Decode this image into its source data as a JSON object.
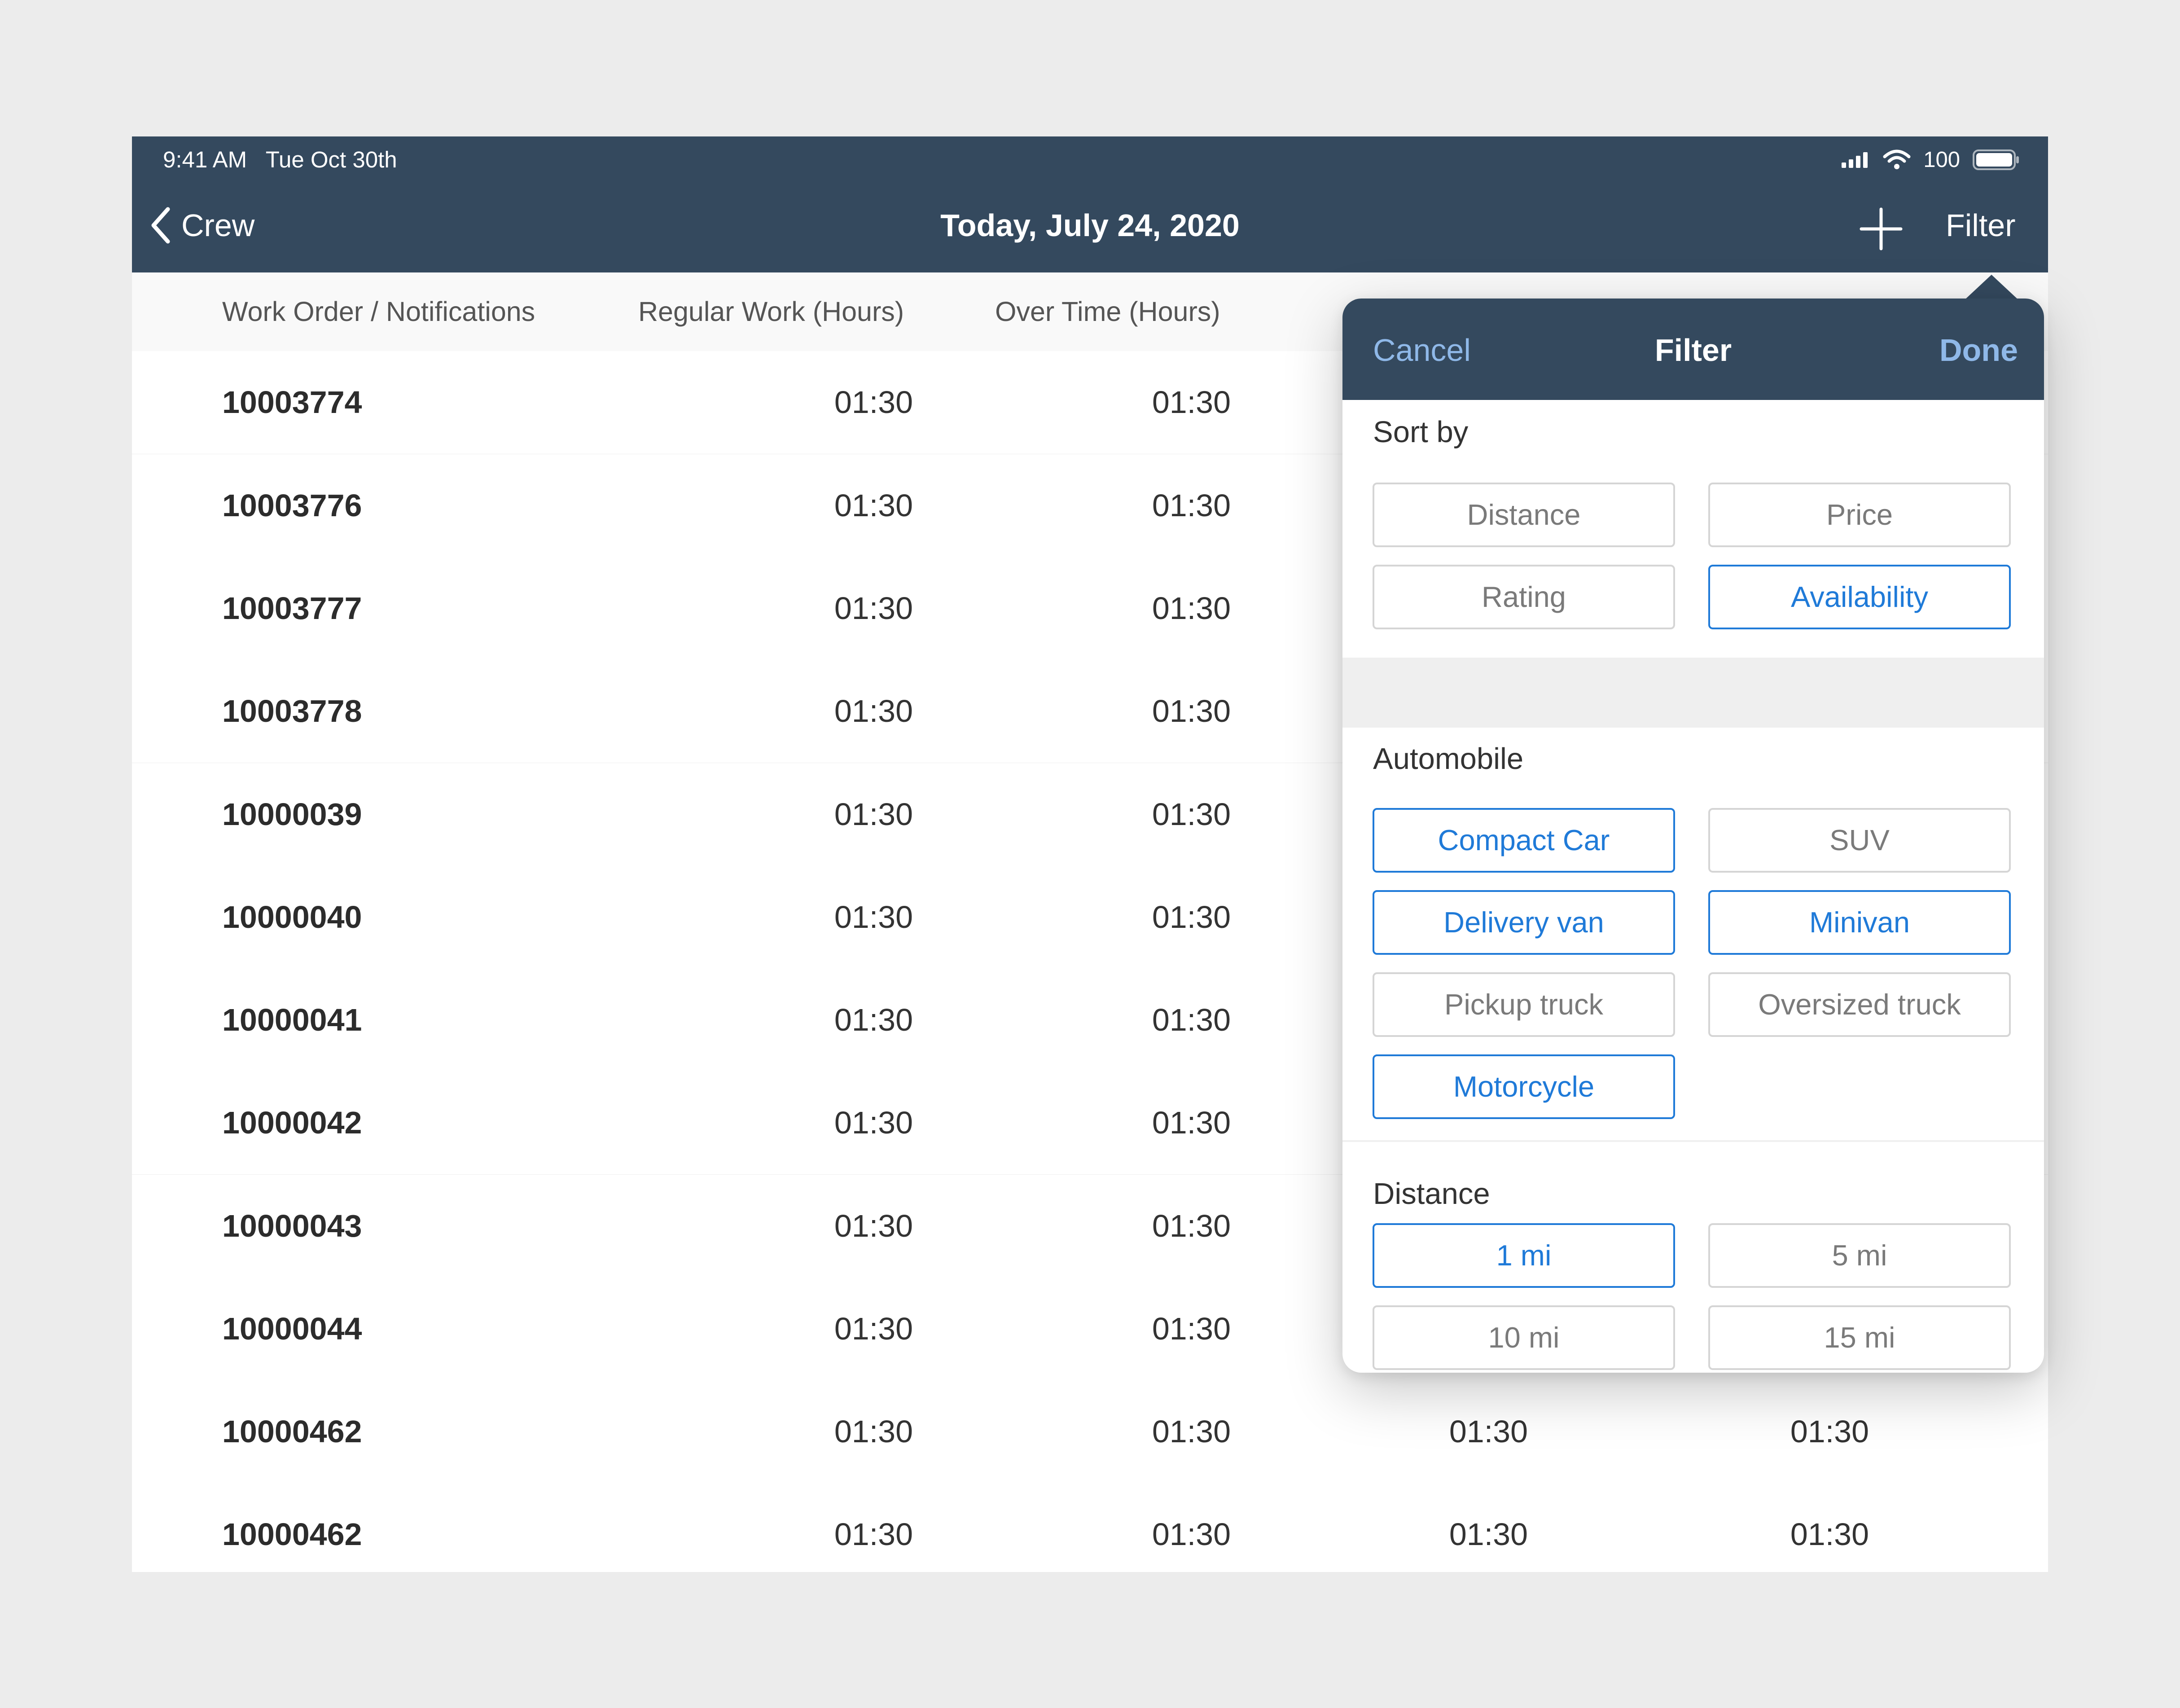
{
  "status_bar": {
    "time": "9:41 AM",
    "date": "Tue Oct 30th",
    "battery": "100",
    "icons": [
      "signal-icon",
      "wifi-icon",
      "battery-icon"
    ]
  },
  "nav": {
    "back_label": "Crew",
    "title": "Today, July 24, 2020",
    "filter_label": "Filter"
  },
  "table": {
    "columns": [
      "Work Order / Notifications",
      "Regular Work (Hours)",
      "Over Time (Hours)"
    ],
    "rows": [
      {
        "id": "10003774",
        "regular": "01:30",
        "overtime": "01:30"
      },
      {
        "id": "10003776",
        "regular": "01:30",
        "overtime": "01:30"
      },
      {
        "id": "10003777",
        "regular": "01:30",
        "overtime": "01:30"
      },
      {
        "id": "10003778",
        "regular": "01:30",
        "overtime": "01:30"
      },
      {
        "id": "10000039",
        "regular": "01:30",
        "overtime": "01:30"
      },
      {
        "id": "10000040",
        "regular": "01:30",
        "overtime": "01:30"
      },
      {
        "id": "10000041",
        "regular": "01:30",
        "overtime": "01:30"
      },
      {
        "id": "10000042",
        "regular": "01:30",
        "overtime": "01:30"
      },
      {
        "id": "10000043",
        "regular": "01:30",
        "overtime": "01:30"
      },
      {
        "id": "10000044",
        "regular": "01:30",
        "overtime": "01:30"
      },
      {
        "id": "10000462",
        "regular": "01:30",
        "overtime": "01:30",
        "col4": "01:30",
        "col5": "01:30"
      },
      {
        "id": "10000462",
        "regular": "01:30",
        "overtime": "01:30",
        "col4": "01:30",
        "col5": "01:30"
      }
    ]
  },
  "filter_popover": {
    "cancel_label": "Cancel",
    "title": "Filter",
    "done_label": "Done",
    "sort_by": {
      "label": "Sort by",
      "options": [
        {
          "label": "Distance",
          "selected": false
        },
        {
          "label": "Price",
          "selected": false
        },
        {
          "label": "Rating",
          "selected": false
        },
        {
          "label": "Availability",
          "selected": true
        }
      ]
    },
    "automobile": {
      "label": "Automobile",
      "options": [
        {
          "label": "Compact Car",
          "selected": true
        },
        {
          "label": "SUV",
          "selected": false
        },
        {
          "label": "Delivery van",
          "selected": true
        },
        {
          "label": "Minivan",
          "selected": true
        },
        {
          "label": "Pickup truck",
          "selected": false
        },
        {
          "label": "Oversized truck",
          "selected": false
        },
        {
          "label": "Motorcycle",
          "selected": true
        }
      ]
    },
    "distance": {
      "label": "Distance",
      "options": [
        {
          "label": "1 mi",
          "selected": true
        },
        {
          "label": "5 mi",
          "selected": false
        },
        {
          "label": "10 mi",
          "selected": false
        },
        {
          "label": "15 mi",
          "selected": false
        }
      ]
    }
  },
  "colors": {
    "header_bg": "#34495e",
    "accent": "#1f7ad8",
    "popover_link": "#8fb8e8",
    "page_bg": "#ececec"
  }
}
